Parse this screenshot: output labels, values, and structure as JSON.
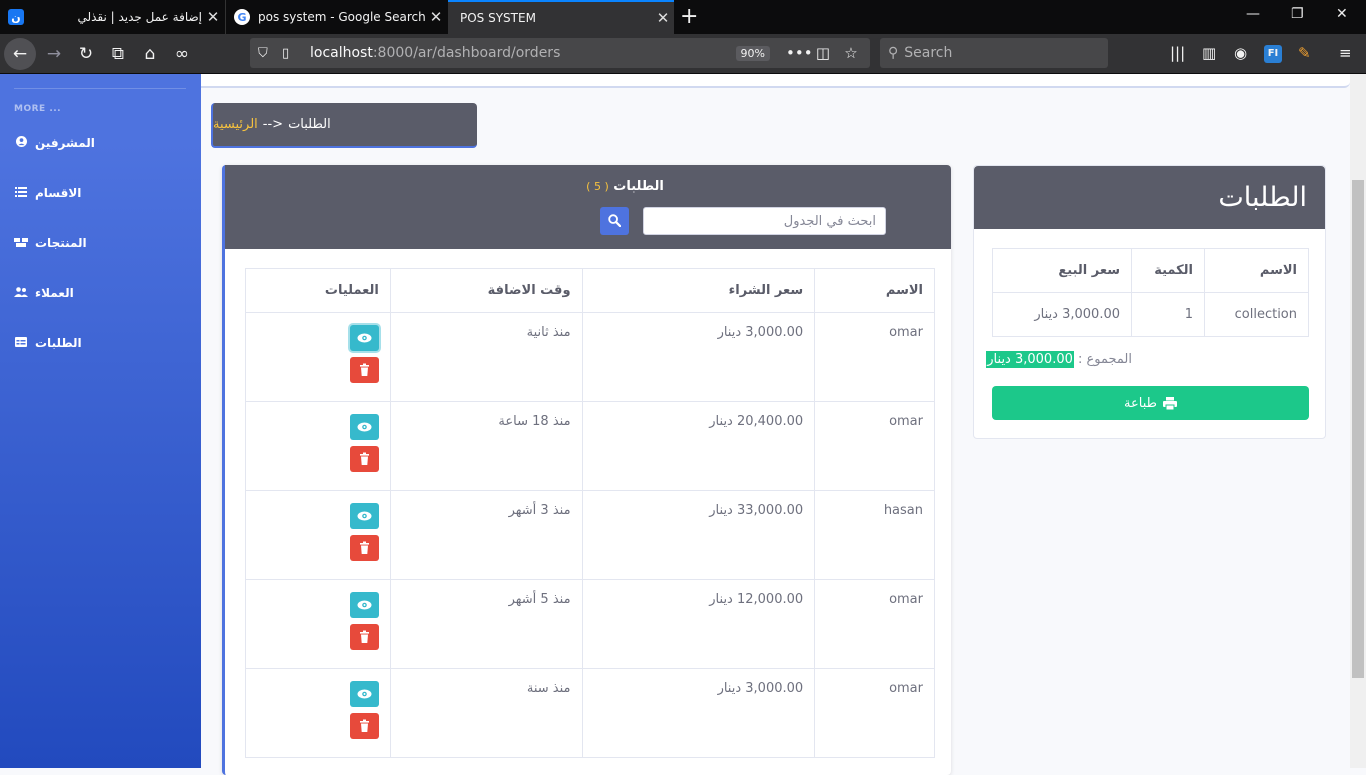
{
  "browser": {
    "tabs": [
      {
        "title": "إضافة عمل جديد | نقذلي",
        "favicon": "ن"
      },
      {
        "title": "pos system - Google Search",
        "favicon": "G"
      },
      {
        "title": "POS SYSTEM",
        "favicon": ""
      }
    ],
    "url_host": "localhost",
    "url_path": ":8000/ar/dashboard/orders",
    "zoom": "90%",
    "search_placeholder": "Search"
  },
  "sidebar": {
    "heading": "MORE ...",
    "items": [
      {
        "label": "المشرفين",
        "icon": "user-circle-icon"
      },
      {
        "label": "الاقسام",
        "icon": "list-icon"
      },
      {
        "label": "المنتجات",
        "icon": "boxes-icon"
      },
      {
        "label": "العملاء",
        "icon": "users-icon"
      },
      {
        "label": "الطلبات",
        "icon": "table-icon"
      }
    ]
  },
  "breadcrumb": {
    "home": "الرئيسية",
    "separator": "-->",
    "current": "الطلبات"
  },
  "orders": {
    "title": "الطلبات",
    "count": "( 5 )",
    "search_placeholder": "ابحث في الجدول",
    "columns": {
      "name": "الاسم",
      "price": "سعر الشراء",
      "time": "وقت الاضافة",
      "ops": "العمليات"
    },
    "rows": [
      {
        "name": "omar",
        "price": "3,000.00 دينار",
        "time": "منذ ثانية"
      },
      {
        "name": "omar",
        "price": "20,400.00 دينار",
        "time": "منذ 18 ساعة"
      },
      {
        "name": "hasan",
        "price": "33,000.00 دينار",
        "time": "منذ 3 أشهر"
      },
      {
        "name": "omar",
        "price": "12,000.00 دينار",
        "time": "منذ 5 أشهر"
      },
      {
        "name": "omar",
        "price": "3,000.00 دينار",
        "time": "منذ سنة"
      }
    ]
  },
  "cart": {
    "title": "الطلبات",
    "columns": {
      "name": "الاسم",
      "qty": "الكمية",
      "price": "سعر البيع"
    },
    "rows": [
      {
        "name": "collection",
        "qty": "1",
        "price": "3,000.00 دينار"
      }
    ],
    "total_label": "المجموع :",
    "total_value": "3,000.00 دينار",
    "print_label": "طباعة"
  },
  "colors": {
    "primary": "#4e73df",
    "info": "#36b9cc",
    "danger": "#e74a3b",
    "success": "#1cc88a",
    "header_gray": "#5a5c69",
    "warning": "#f6c23e"
  }
}
